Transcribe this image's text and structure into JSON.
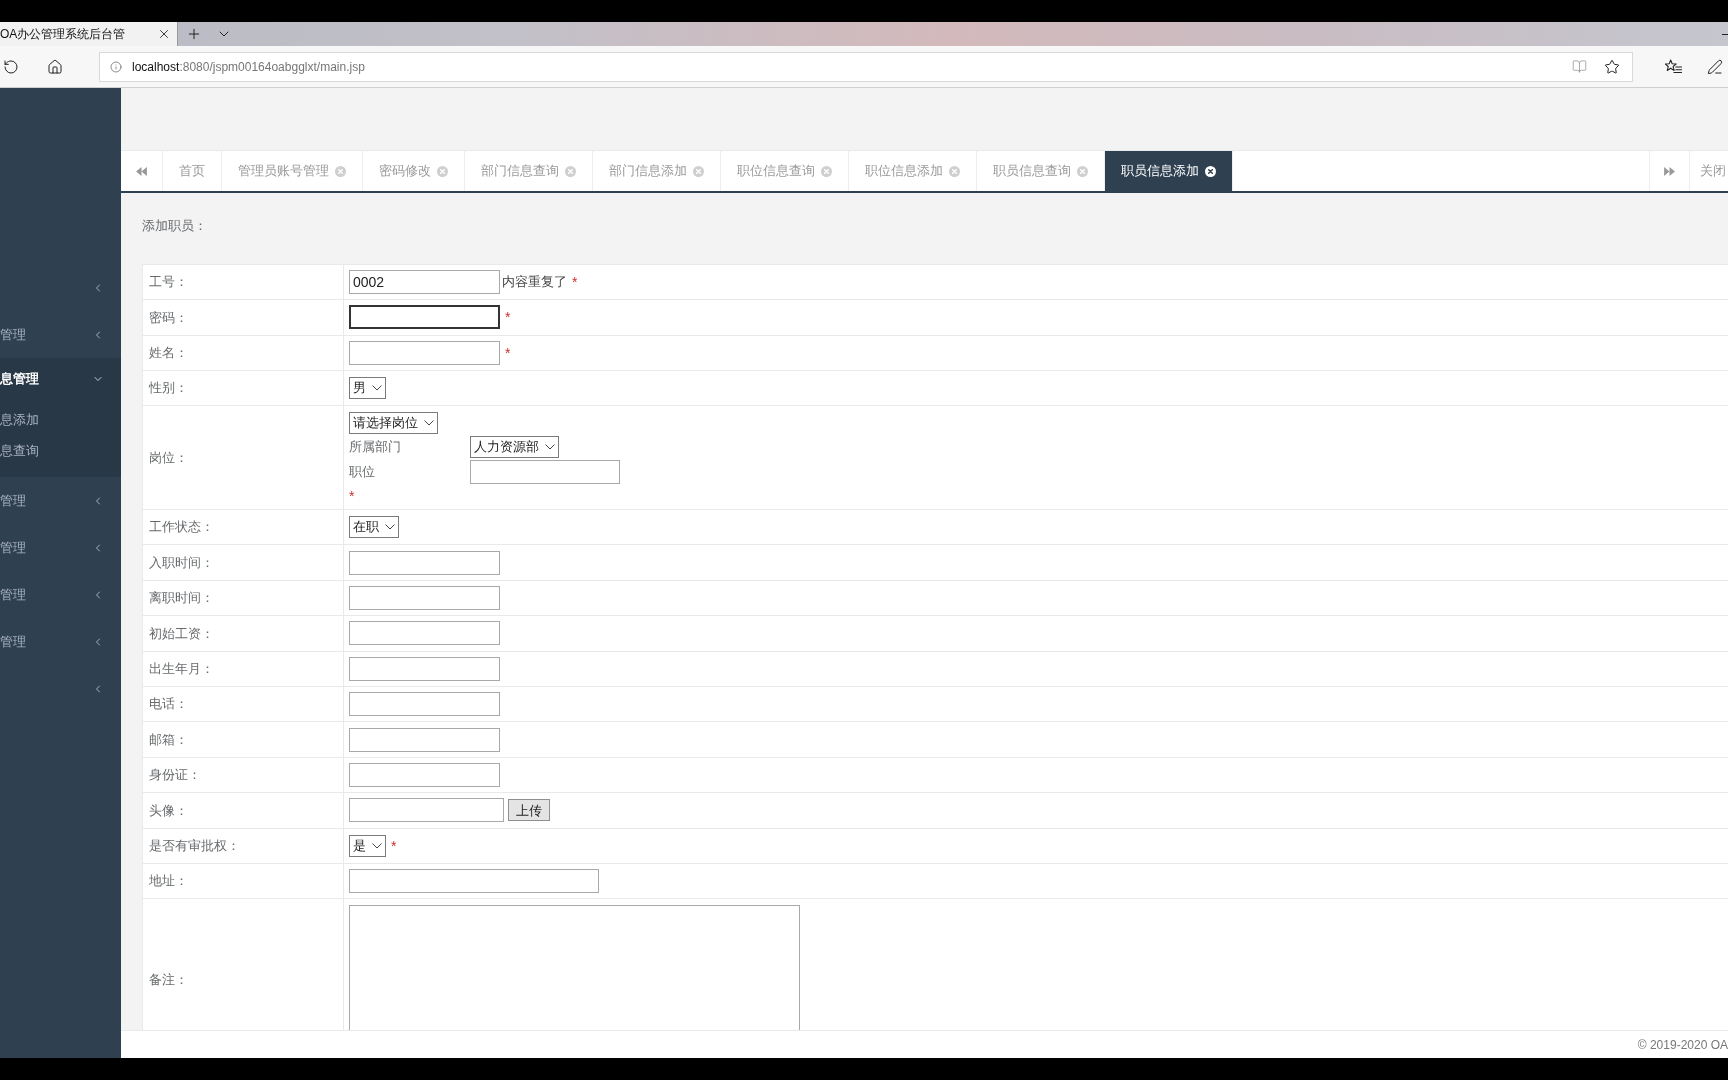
{
  "browser": {
    "tab_title": "OA办公管理系统后台管",
    "url_host": "localhost",
    "url_path": ":8080/jspm00164oabgglxt/main.jsp"
  },
  "sidebar": {
    "items": [
      {
        "expanded": false
      },
      {
        "label": "管理",
        "expanded": false
      },
      {
        "label": "息管理",
        "expanded": true,
        "children": [
          {
            "label": "息添加"
          },
          {
            "label": "息查询"
          }
        ]
      },
      {
        "label": "管理",
        "expanded": false
      },
      {
        "label": "管理",
        "expanded": false
      },
      {
        "label": "管理",
        "expanded": false
      },
      {
        "label": "管理",
        "expanded": false
      },
      {
        "expanded": false
      }
    ]
  },
  "tabs": {
    "items": [
      {
        "label": "首页",
        "closable": false,
        "selected": false
      },
      {
        "label": "管理员账号管理",
        "closable": true,
        "selected": false
      },
      {
        "label": "密码修改",
        "closable": true,
        "selected": false
      },
      {
        "label": "部门信息查询",
        "closable": true,
        "selected": false
      },
      {
        "label": "部门信息添加",
        "closable": true,
        "selected": false
      },
      {
        "label": "职位信息查询",
        "closable": true,
        "selected": false
      },
      {
        "label": "职位信息添加",
        "closable": true,
        "selected": false
      },
      {
        "label": "职员信息查询",
        "closable": true,
        "selected": false
      },
      {
        "label": "职员信息添加",
        "closable": true,
        "selected": true
      }
    ],
    "close_label": "关闭"
  },
  "form": {
    "title": "添加职员：",
    "rows": [
      {
        "kind": "text",
        "label": "工号：",
        "value": "0002",
        "focused": false,
        "message": "内容重复了",
        "required_mark": "*"
      },
      {
        "kind": "text",
        "label": "密码：",
        "focused": true,
        "required_mark": "*"
      },
      {
        "kind": "text",
        "label": "姓名：",
        "focused": false,
        "required_mark": "*"
      },
      {
        "kind": "select",
        "label": "性别：",
        "value": "男"
      },
      {
        "kind": "position",
        "label": "岗位：",
        "value": "请选择岗位",
        "department_label": "所属部门",
        "department_value": "人力资源部",
        "post_label": "职位",
        "required_mark": "*"
      },
      {
        "kind": "select",
        "label": "工作状态：",
        "value": "在职"
      },
      {
        "kind": "text",
        "label": "入职时间：",
        "focused": false
      },
      {
        "kind": "text",
        "label": "离职时间：",
        "focused": false
      },
      {
        "kind": "text",
        "label": "初始工资：",
        "focused": false
      },
      {
        "kind": "text",
        "label": "出生年月：",
        "focused": false
      },
      {
        "kind": "text",
        "label": "电话：",
        "focused": false
      },
      {
        "kind": "text",
        "label": "邮箱：",
        "focused": false
      },
      {
        "kind": "text",
        "label": "身份证：",
        "focused": false
      },
      {
        "kind": "upload",
        "label": "头像：",
        "button": "上传"
      },
      {
        "kind": "select",
        "label": "是否有审批权：",
        "value": "是",
        "required_mark": "*"
      },
      {
        "kind": "wide_text",
        "label": "地址：",
        "focused": false
      },
      {
        "kind": "textarea",
        "label": "备注："
      }
    ]
  },
  "footer": {
    "copyright": "© 2019-2020 OA"
  }
}
